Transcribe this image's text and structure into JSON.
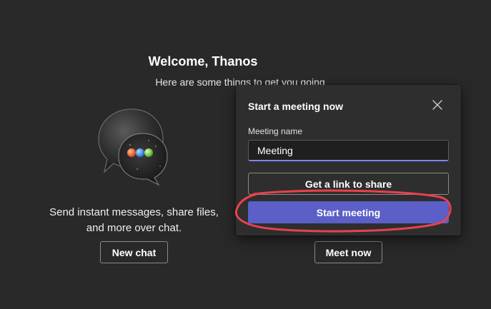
{
  "welcome": {
    "title": "Welcome, Thanos",
    "subtitle": "Here are some things to get you going"
  },
  "chat_section": {
    "description_line1": "Send instant messages, share files,",
    "description_line2": "and more over chat.",
    "new_chat_label": "New chat",
    "illustration_icon": "chat-bubbles-icon"
  },
  "meet_section": {
    "meet_now_label": "Meet now"
  },
  "popup": {
    "title": "Start a meeting now",
    "close_icon": "close-icon",
    "field_label": "Meeting name",
    "meeting_name_value": "Meeting",
    "get_link_label": "Get a link to share",
    "start_meeting_label": "Start meeting"
  },
  "colors": {
    "background": "#292929",
    "popup_background": "#2e2e2e",
    "accent": "#5b5fc7",
    "input_focus": "#7f85f5",
    "annotation": "#e8414f"
  }
}
